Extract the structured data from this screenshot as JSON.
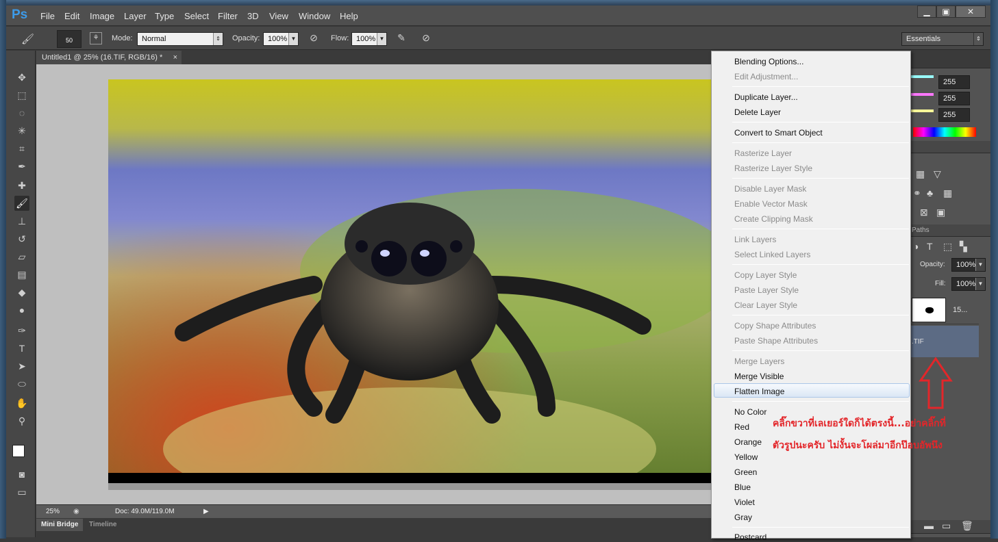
{
  "app": {
    "logo": "Ps"
  },
  "menu": [
    "File",
    "Edit",
    "Image",
    "Layer",
    "Type",
    "Select",
    "Filter",
    "3D",
    "View",
    "Window",
    "Help"
  ],
  "window_controls": [
    "minimize-icon",
    "restore-icon",
    "close-icon"
  ],
  "options": {
    "brush_size": "50",
    "mode_label": "Mode:",
    "mode_value": "Normal",
    "opacity_label": "Opacity:",
    "opacity_value": "100%",
    "flow_label": "Flow:",
    "flow_value": "100%",
    "workspace": "Essentials"
  },
  "document_tab": {
    "title": "Untitled1 @ 25% (16.TIF, RGB/16) *",
    "close": "×"
  },
  "status": {
    "zoom": "25%",
    "doc": "Doc: 49.0M/119.0M"
  },
  "bottom_tabs": [
    "Mini Bridge",
    "Timeline"
  ],
  "right_panel": {
    "color_values": [
      "255",
      "255",
      "255"
    ],
    "paths_tab": "Paths",
    "opacity_label": "Opacity:",
    "opacity_value": "100%",
    "fill_label": "Fill:",
    "fill_value": "100%",
    "layer1_name": "15...",
    "layer2_name": ".TIF"
  },
  "context_menu": {
    "items": [
      {
        "label": "Blending Options...",
        "enabled": true
      },
      {
        "label": "Edit Adjustment...",
        "enabled": false
      },
      {
        "label": "Duplicate Layer...",
        "enabled": true
      },
      {
        "label": "Delete Layer",
        "enabled": true
      },
      {
        "label": "Convert to Smart Object",
        "enabled": true
      },
      {
        "label": "Rasterize Layer",
        "enabled": false
      },
      {
        "label": "Rasterize Layer Style",
        "enabled": false
      },
      {
        "label": "Disable Layer Mask",
        "enabled": false
      },
      {
        "label": "Enable Vector Mask",
        "enabled": false
      },
      {
        "label": "Create Clipping Mask",
        "enabled": false
      },
      {
        "label": "Link Layers",
        "enabled": false
      },
      {
        "label": "Select Linked Layers",
        "enabled": false
      },
      {
        "label": "Copy Layer Style",
        "enabled": false
      },
      {
        "label": "Paste Layer Style",
        "enabled": false
      },
      {
        "label": "Clear Layer Style",
        "enabled": false
      },
      {
        "label": "Copy Shape Attributes",
        "enabled": false
      },
      {
        "label": "Paste Shape Attributes",
        "enabled": false
      },
      {
        "label": "Merge Layers",
        "enabled": false
      },
      {
        "label": "Merge Visible",
        "enabled": true
      },
      {
        "label": "Flatten Image",
        "enabled": true,
        "highlighted": true
      },
      {
        "label": "No Color",
        "enabled": true
      },
      {
        "label": "Red",
        "enabled": true
      },
      {
        "label": "Orange",
        "enabled": true
      },
      {
        "label": "Yellow",
        "enabled": true
      },
      {
        "label": "Green",
        "enabled": true
      },
      {
        "label": "Blue",
        "enabled": true
      },
      {
        "label": "Violet",
        "enabled": true
      },
      {
        "label": "Gray",
        "enabled": true
      },
      {
        "label": "Postcard",
        "enabled": true
      }
    ]
  },
  "annotation": {
    "line1": "คลิ๊กขวาที่เลเยอร์ใดก็ได้ตรงนี้...อย่าคลิ๊กที่",
    "line2": "ตัวรูปนะครับ   ไม่งั้นจะโผล่มาอีกป๊อบอัพนึง",
    "color": "#e3262a"
  }
}
